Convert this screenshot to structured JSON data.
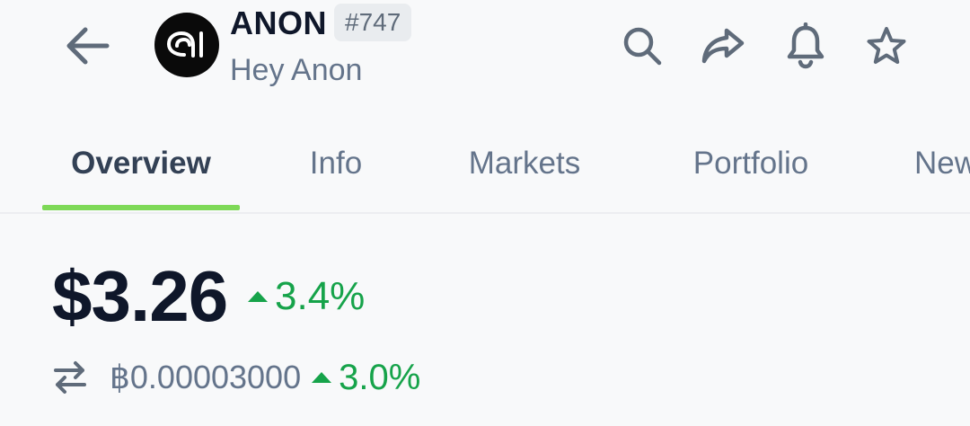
{
  "header": {
    "coin_name": "ANON",
    "rank": "#747",
    "subtitle": "Hey Anon",
    "logo_icon": "hey-anon-logo",
    "actions": [
      "search-icon",
      "share-icon",
      "bell-icon",
      "star-icon"
    ]
  },
  "tabs": [
    {
      "label": "Overview",
      "active": true
    },
    {
      "label": "Info",
      "active": false
    },
    {
      "label": "Markets",
      "active": false
    },
    {
      "label": "Portfolio",
      "active": false
    },
    {
      "label": "News",
      "active": false
    }
  ],
  "price": {
    "usd": "$3.26",
    "usd_change": "3.4%",
    "btc": "฿0.00003000",
    "btc_change": "3.0%",
    "change_direction": "up"
  },
  "colors": {
    "accent_green": "#16a34a",
    "tab_underline": "#7ed957",
    "text_primary": "#0f172a",
    "text_secondary": "#64748b",
    "icon": "#5f6b7a"
  }
}
